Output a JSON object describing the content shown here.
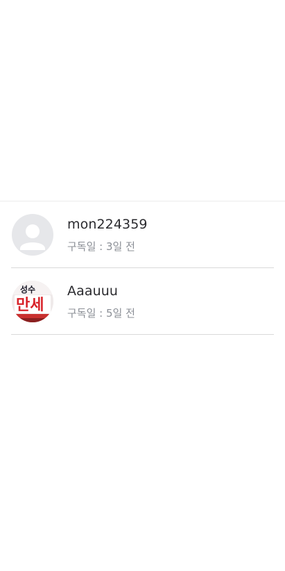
{
  "subscribers": [
    {
      "nickname": "mon224359",
      "subscribed_text": "구독일 : 3일 전",
      "avatar": "default-user-icon"
    },
    {
      "nickname": "Aaauuu",
      "subscribed_text": "구독일 : 5일 전",
      "avatar": "profile-photo",
      "avatar_photo_text": {
        "line1": "성수",
        "line2": "만세"
      }
    }
  ],
  "colors": {
    "divider": "#d9d9d9",
    "nickname": "#2b2b2f",
    "meta": "#8b8f96",
    "avatar_bg": "#e6e7ea",
    "accent_red": "#d8232a"
  }
}
